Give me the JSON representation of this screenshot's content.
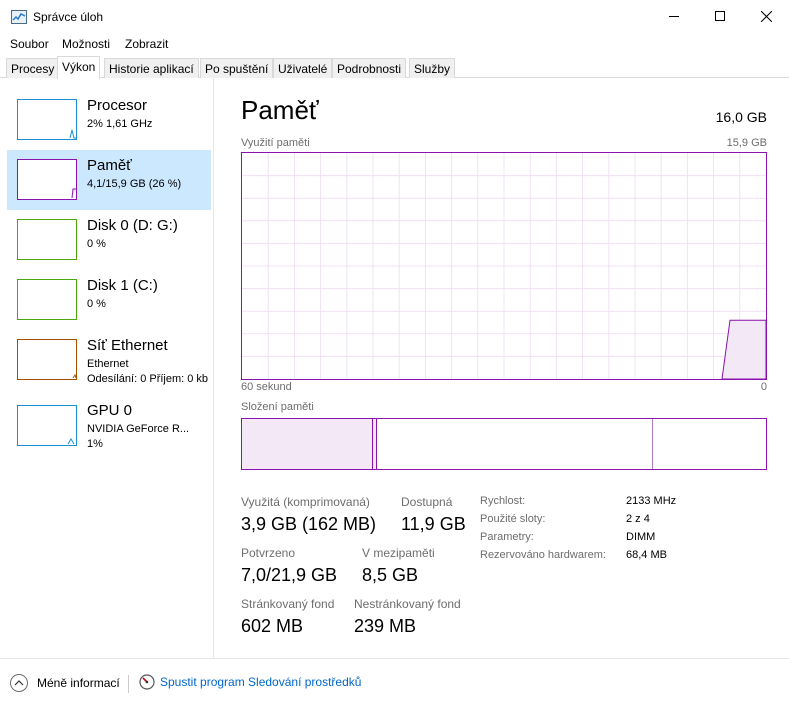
{
  "window": {
    "title": "Správce úloh"
  },
  "menu": [
    "Soubor",
    "Možnosti",
    "Zobrazit"
  ],
  "tabs": [
    {
      "label": "Procesy",
      "active": false
    },
    {
      "label": "Výkon",
      "active": true
    },
    {
      "label": "Historie aplikací",
      "active": false
    },
    {
      "label": "Po spuštění",
      "active": false
    },
    {
      "label": "Uživatelé",
      "active": false
    },
    {
      "label": "Podrobnosti",
      "active": false
    },
    {
      "label": "Služby",
      "active": false
    }
  ],
  "sidebar": {
    "items": [
      {
        "title": "Procesor",
        "sub": "2% 1,61 GHz",
        "sub2": "",
        "color": "#1a8fd6",
        "selected": false
      },
      {
        "title": "Paměť",
        "sub": "4,1/15,9 GB (26 %)",
        "sub2": "",
        "color": "#8b12ae",
        "selected": true
      },
      {
        "title": "Disk 0 (D: G:)",
        "sub": "0 %",
        "sub2": "",
        "color": "#4da60c",
        "selected": false
      },
      {
        "title": "Disk 1 (C:)",
        "sub": "0 %",
        "sub2": "",
        "color": "#4da60c",
        "selected": false
      },
      {
        "title": "Síť Ethernet",
        "sub": "Ethernet",
        "sub2": "Odesílání: 0 Příjem: 0 kb",
        "color": "#a74f01",
        "selected": false
      },
      {
        "title": "GPU 0",
        "sub": "NVIDIA GeForce R...",
        "sub2": "1%",
        "color": "#1a8fd6",
        "selected": false
      }
    ]
  },
  "main": {
    "title": "Paměť",
    "total": "16,0 GB",
    "graph_label": "Využití paměti",
    "graph_max": "15,9 GB",
    "graph_time_left": "60 sekund",
    "graph_time_right": "0",
    "composition_label": "Složení paměti",
    "graph_accent": "#8b12ae",
    "usage_fraction": 0.26
  },
  "stats": {
    "in_use_label": "Využitá (komprimovaná)",
    "in_use_value": "3,9 GB (162 MB)",
    "available_label": "Dostupná",
    "available_value": "11,9 GB",
    "committed_label": "Potvrzeno",
    "committed_value": "7,0/21,9 GB",
    "cached_label": "V mezipaměti",
    "cached_value": "8,5 GB",
    "paged_label": "Stránkovaný fond",
    "paged_value": "602 MB",
    "nonpaged_label": "Nestránkovaný fond",
    "nonpaged_value": "239 MB"
  },
  "details": [
    {
      "key": "Rychlost:",
      "value": "2133 MHz"
    },
    {
      "key": "Použité sloty:",
      "value": "2 z 4"
    },
    {
      "key": "Parametry:",
      "value": "DIMM"
    },
    {
      "key": "Rezervováno hardwarem:",
      "value": "68,4 MB"
    }
  ],
  "footer": {
    "fewer_label": "Méně informací",
    "monitor_label": "Spustit program Sledování prostředků"
  }
}
